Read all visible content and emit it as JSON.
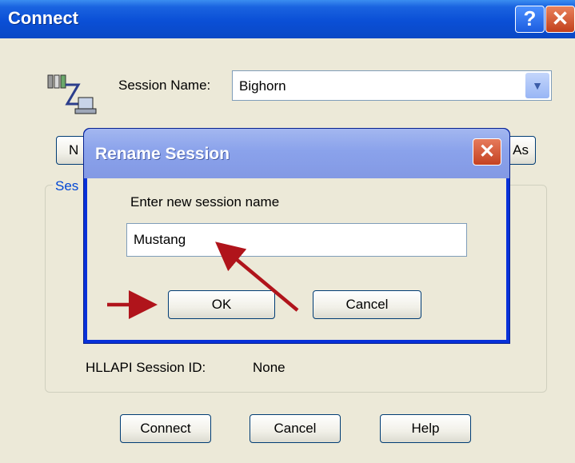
{
  "window": {
    "title": "Connect",
    "help_glyph": "?",
    "close_glyph": "✕"
  },
  "connect": {
    "session_name_label": "Session Name:",
    "session_name_value": "Bighorn",
    "combo_arrow_icon": "chevron-down-icon",
    "new_button_partial": "N",
    "save_as_button_partial": "As",
    "group_title_partial": "Ses",
    "hllapi_label": "HLLAPI Session ID:",
    "hllapi_value": "None",
    "buttons": {
      "connect": "Connect",
      "cancel": "Cancel",
      "help": "Help"
    }
  },
  "rename_dialog": {
    "title": "Rename Session",
    "close_glyph": "✕",
    "prompt": "Enter new session name",
    "input_value": "Mustang",
    "ok": "OK",
    "cancel": "Cancel"
  },
  "colors": {
    "window_bg": "#ece9d8",
    "titlebar_blue": "#0a4fd6",
    "dialog_titlebar": "#8aa2eb",
    "close_red": "#c2401c",
    "annotation_arrow": "#b0141b",
    "group_title_blue": "#0046d5"
  }
}
